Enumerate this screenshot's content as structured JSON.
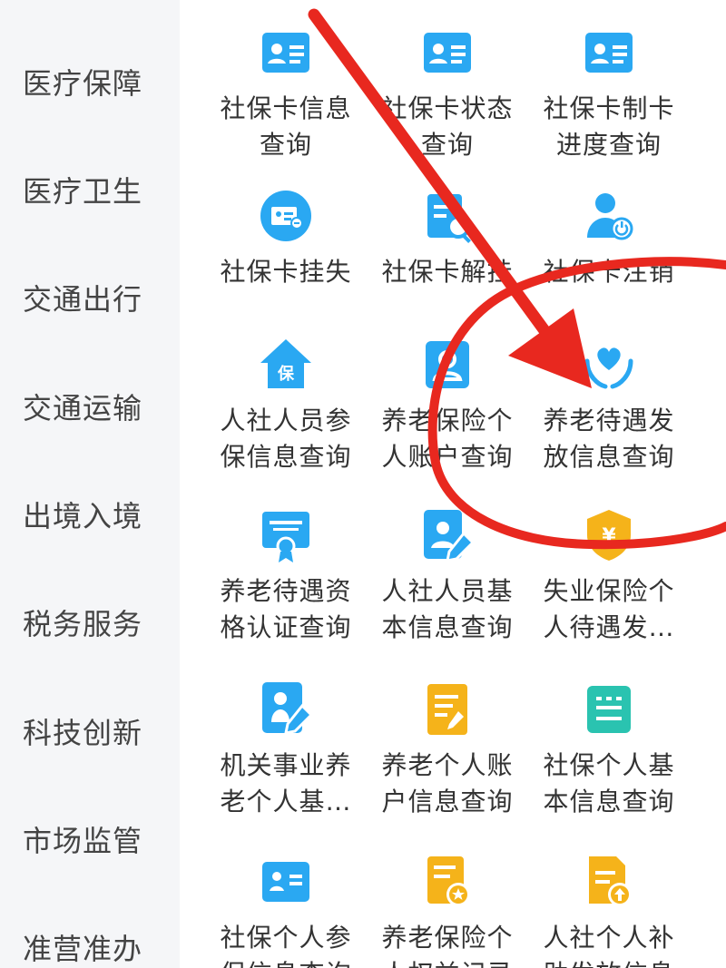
{
  "sidebar": {
    "items": [
      {
        "label": "医疗保障"
      },
      {
        "label": "医疗卫生"
      },
      {
        "label": "交通出行"
      },
      {
        "label": "交通运输"
      },
      {
        "label": "出境入境"
      },
      {
        "label": "税务服务"
      },
      {
        "label": "科技创新"
      },
      {
        "label": "市场监管"
      },
      {
        "label": "准营准办"
      }
    ]
  },
  "services": [
    {
      "label": "社保卡信息\n查询",
      "icon": "id-card-icon",
      "color": "#2aa8f2"
    },
    {
      "label": "社保卡状态\n查询",
      "icon": "id-card-icon",
      "color": "#2aa8f2"
    },
    {
      "label": "社保卡制卡\n进度查询",
      "icon": "id-card-icon",
      "color": "#2aa8f2"
    },
    {
      "label": "社保卡挂失",
      "icon": "card-lock-icon",
      "color": "#2aa8f2"
    },
    {
      "label": "社保卡解挂",
      "icon": "card-search-icon",
      "color": "#2aa8f2"
    },
    {
      "label": "社保卡注销",
      "icon": "person-power-icon",
      "color": "#2aa8f2"
    },
    {
      "label": "人社人员参\n保信息查询",
      "icon": "house-bao-icon",
      "color": "#2aa8f2"
    },
    {
      "label": "养老保险个\n人账户查询",
      "icon": "person-card-icon",
      "color": "#2aa8f2"
    },
    {
      "label": "养老待遇发\n放信息查询",
      "icon": "hands-heart-icon",
      "color": "#2aa8f2"
    },
    {
      "label": "养老待遇资\n格认证查询",
      "icon": "certificate-icon",
      "color": "#2aa8f2"
    },
    {
      "label": "人社人员基\n本信息查询",
      "icon": "person-edit-icon",
      "color": "#2aa8f2"
    },
    {
      "label": "失业保险个\n人待遇发…",
      "icon": "yen-shield-icon",
      "color": "#f5b31a"
    },
    {
      "label": "机关事业养\n老个人基…",
      "icon": "elder-edit-icon",
      "color": "#2aa8f2"
    },
    {
      "label": "养老个人账\n户信息查询",
      "icon": "document-edit-icon",
      "color": "#f5b31a"
    },
    {
      "label": "社保个人基\n本信息查询",
      "icon": "list-card-icon",
      "color": "#2ac3b0"
    },
    {
      "label": "社保个人参\n保信息查询",
      "icon": "profile-list-icon",
      "color": "#2aa8f2"
    },
    {
      "label": "养老保险个\n人权益记录",
      "icon": "document-star-icon",
      "color": "#f5b31a"
    },
    {
      "label": "人社个人补\n助发放信息",
      "icon": "document-upload-icon",
      "color": "#f5b31a"
    }
  ]
}
